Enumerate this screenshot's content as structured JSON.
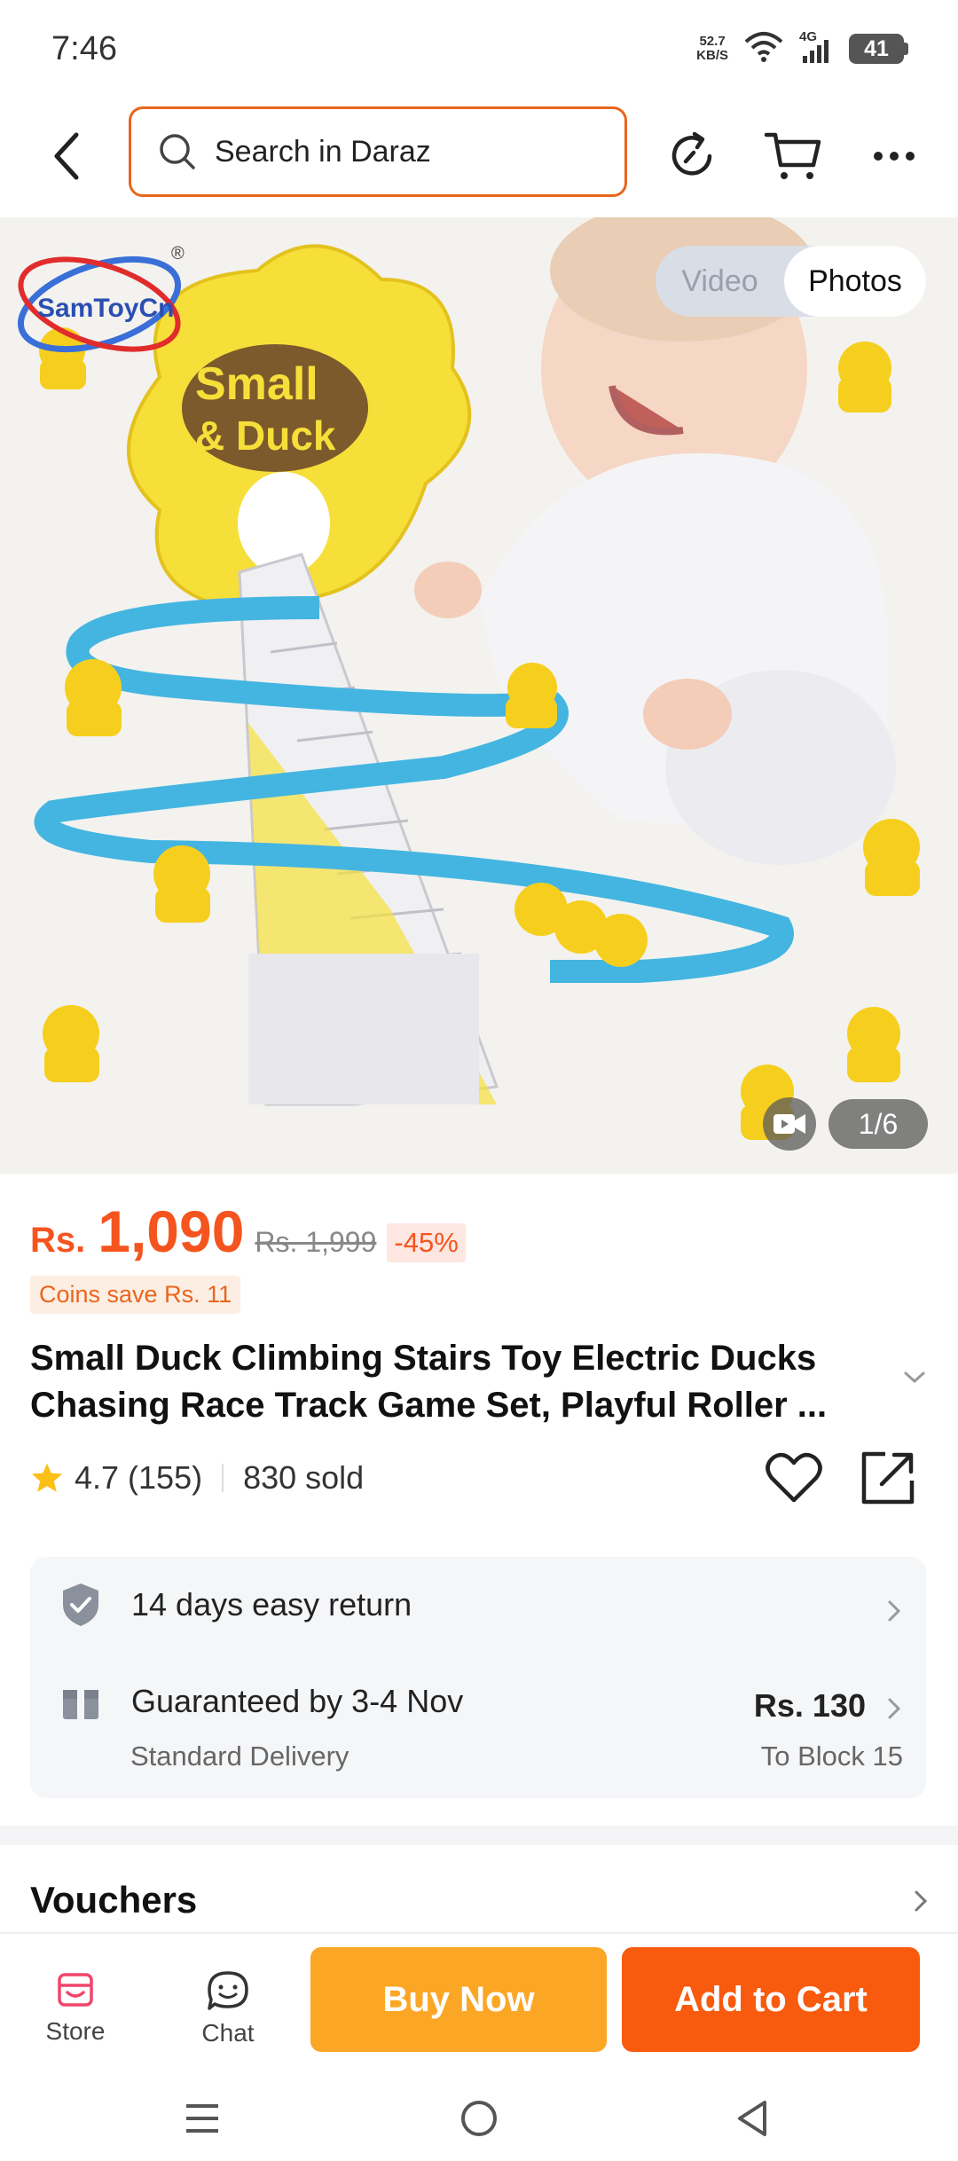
{
  "status_bar": {
    "time": "7:46",
    "net_speed_value": "52.7",
    "net_speed_unit": "KB/S",
    "network_type": "4G",
    "battery": "41"
  },
  "nav": {
    "search_placeholder": "Search in Daraz",
    "icons": [
      "back-icon",
      "search-icon",
      "refresh-share-icon",
      "cart-icon",
      "more-icon"
    ]
  },
  "gallery": {
    "video_label": "Video",
    "photos_label": "Photos",
    "counter": "1/6",
    "brand_logo": "SamToyCn",
    "image_text_1": "Small",
    "image_text_2": "& Duck"
  },
  "price": {
    "currency": "Rs.",
    "current": "1,090",
    "original": "Rs. 1,999",
    "discount": "-45%",
    "coins": "Coins save Rs. 11"
  },
  "product": {
    "title_line1": "Small Duck Climbing Stairs Toy Electric Ducks",
    "title_line2": "Chasing Race Track Game Set, Playful Roller ...",
    "rating": "4.7",
    "reviews": "(155)",
    "sold": "830 sold"
  },
  "service": {
    "return_text": "14 days easy return",
    "delivery_text": "Guaranteed by 3-4 Nov",
    "delivery_type": "Standard Delivery",
    "delivery_price": "Rs. 130",
    "delivery_location": "To Block 15"
  },
  "vouchers": {
    "label": "Vouchers"
  },
  "actions": {
    "store": "Store",
    "chat": "Chat",
    "buy_now": "Buy Now",
    "add_to_cart": "Add to Cart"
  },
  "colors": {
    "accent": "#f5541e",
    "buy_now_bg": "#fca626",
    "add_to_cart_bg": "#f85a0e",
    "search_border": "#e8661c"
  }
}
